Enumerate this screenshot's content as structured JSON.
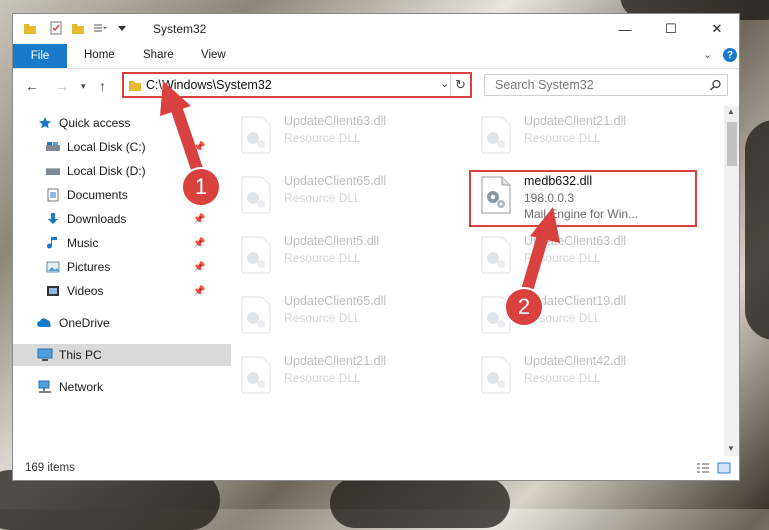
{
  "window": {
    "title": "System32",
    "controls": {
      "minimize": "—",
      "maximize": "☐",
      "close": "✕"
    }
  },
  "ribbon": {
    "tabs": [
      "File",
      "Home",
      "Share",
      "View"
    ],
    "help": "?"
  },
  "nav": {
    "address": "C:\\Windows\\System32",
    "search_placeholder": "Search System32"
  },
  "sidebar": {
    "items": [
      {
        "label": "Quick access",
        "icon": "star-icon"
      },
      {
        "label": "Local Disk (C:)",
        "icon": "drive-icon",
        "pinned": true
      },
      {
        "label": "Local Disk (D:)",
        "icon": "drive-icon"
      },
      {
        "label": "Documents",
        "icon": "documents-icon"
      },
      {
        "label": "Downloads",
        "icon": "download-icon",
        "pinned": true
      },
      {
        "label": "Music",
        "icon": "music-icon",
        "pinned": true
      },
      {
        "label": "Pictures",
        "icon": "pictures-icon",
        "pinned": true
      },
      {
        "label": "Videos",
        "icon": "videos-icon",
        "pinned": true
      },
      {
        "label": "OneDrive",
        "icon": "cloud-icon"
      },
      {
        "label": "This PC",
        "icon": "computer-icon",
        "selected": true
      },
      {
        "label": "Network",
        "icon": "network-icon"
      }
    ]
  },
  "files": [
    {
      "name": "UpdateClient63.dll",
      "desc": "Resource DLL"
    },
    {
      "name": "UpdateClient21.dll",
      "desc": "Resource DLL"
    },
    {
      "name": "UpdateClient65.dll",
      "desc": "Resource DLL"
    },
    {
      "name": "medb632.dll",
      "desc": "198.0.0.3",
      "desc2": "Mail Engine for Win..."
    },
    {
      "name": "UpdateClient5.dll",
      "desc": "Resource DLL"
    },
    {
      "name": "UpdateClient63.dll",
      "desc": "Resource DLL"
    },
    {
      "name": "UpdateClient65.dll",
      "desc": "Resource DLL"
    },
    {
      "name": "UpdateClient19.dll",
      "desc": "Resource DLL"
    },
    {
      "name": "UpdateClient21.dll",
      "desc": "Resource DLL"
    },
    {
      "name": "UpdateClient42.dll",
      "desc": "Resource DLL"
    }
  ],
  "status": {
    "count": "169 items"
  },
  "annotations": [
    {
      "number": "1"
    },
    {
      "number": "2"
    }
  ],
  "colors": {
    "accent": "#1979ca",
    "annotation": "#d9413f"
  }
}
